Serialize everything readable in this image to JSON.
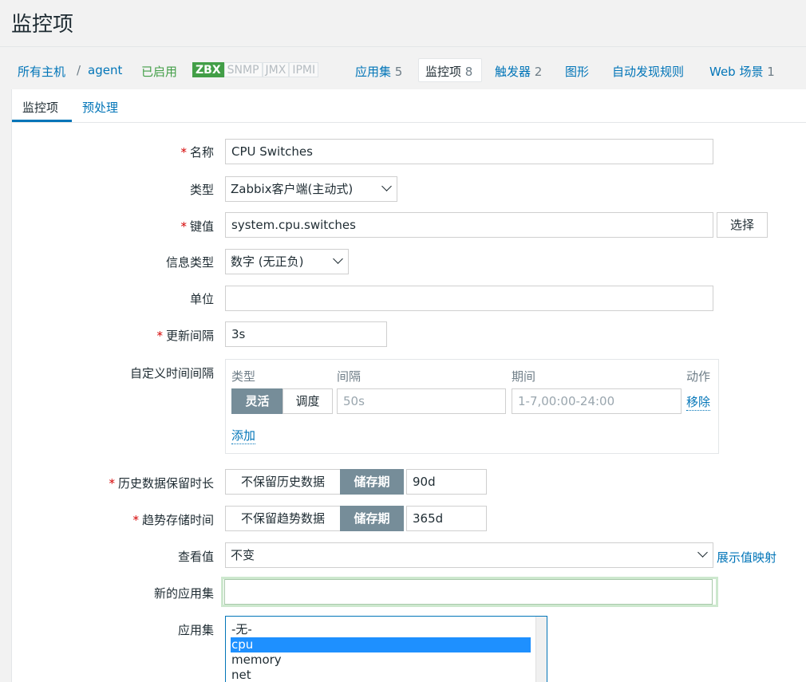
{
  "page_title": "监控项",
  "breadcrumb": {
    "all_hosts": "所有主机",
    "sep": "/",
    "host": "agent",
    "status": "已启用",
    "badges": [
      "ZBX",
      "SNMP",
      "JMX",
      "IPMI"
    ]
  },
  "nav": {
    "app_sets": {
      "label": "应用集",
      "count": "5"
    },
    "items": {
      "label": "监控项",
      "count": "8"
    },
    "triggers": {
      "label": "触发器",
      "count": "2"
    },
    "graphs": {
      "label": "图形"
    },
    "discovery": {
      "label": "自动发现规则"
    },
    "web": {
      "label": "Web 场景",
      "count": "1"
    }
  },
  "subtabs": [
    "监控项",
    "预处理"
  ],
  "form": {
    "name": {
      "label": "名称",
      "value": "CPU Switches"
    },
    "type": {
      "label": "类型",
      "value": "Zabbix客户端(主动式)"
    },
    "key": {
      "label": "键值",
      "value": "system.cpu.switches",
      "select_label": "选择"
    },
    "info_type": {
      "label": "信息类型",
      "value": "数字 (无正负)"
    },
    "units": {
      "label": "单位",
      "value": ""
    },
    "update_interval": {
      "label": "更新间隔",
      "value": "3s"
    },
    "custom_intervals": {
      "label": "自定义时间间隔",
      "headers": [
        "类型",
        "间隔",
        "期间",
        "动作"
      ],
      "row": {
        "mode_on": "灵活",
        "mode_off": "调度",
        "interval_placeholder": "50s",
        "period_placeholder": "1-7,00:00-24:00",
        "remove": "移除"
      },
      "add": "添加"
    },
    "history": {
      "label": "历史数据保留时长",
      "off": "不保留历史数据",
      "on": "储存期",
      "value": "90d"
    },
    "trends": {
      "label": "趋势存储时间",
      "off": "不保留趋势数据",
      "on": "储存期",
      "value": "365d"
    },
    "show_value": {
      "label": "查看值",
      "value": "不变",
      "link": "展示值映射"
    },
    "new_app": {
      "label": "新的应用集",
      "value": ""
    },
    "apps": {
      "label": "应用集",
      "options": [
        "-无-",
        "cpu",
        "memory",
        "net"
      ],
      "selected": "cpu"
    }
  }
}
